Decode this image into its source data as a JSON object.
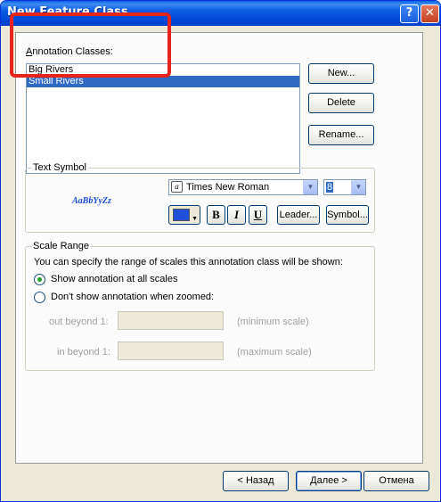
{
  "window": {
    "title": "New Feature Class",
    "help_glyph": "?",
    "close_glyph": "✕"
  },
  "annotation": {
    "label": "Annotation Classes:",
    "items": [
      "Big Rivers",
      "Small Rivers"
    ],
    "selected_index": 1,
    "new_label": "New...",
    "delete_label": "Delete",
    "rename_label": "Rename..."
  },
  "text_symbol": {
    "title": "Text Symbol",
    "preview": "AaBbYyZz",
    "font": "Times New Roman",
    "size": "8",
    "bold": "B",
    "italic": "I",
    "underline": "U",
    "leader_label": "Leader...",
    "symbol_label": "Symbol...",
    "color": "#1f4fd8"
  },
  "scale_range": {
    "title": "Scale Range",
    "description": "You can specify the range of scales this annotation class will be shown:",
    "option_all": "Show annotation at all scales",
    "option_zoomed": "Don't show annotation when zoomed:",
    "out_label": "out beyond 1:",
    "in_label": "in beyond 1:",
    "min_hint": "(minimum scale)",
    "max_hint": "(maximum scale)"
  },
  "footer": {
    "back_label": "< Назад",
    "next_label": "Далее >",
    "cancel_label": "Отмена"
  },
  "colors": {
    "titlebar": "#0054e3",
    "selection": "#316ac5",
    "highlight": "#e8231b"
  }
}
